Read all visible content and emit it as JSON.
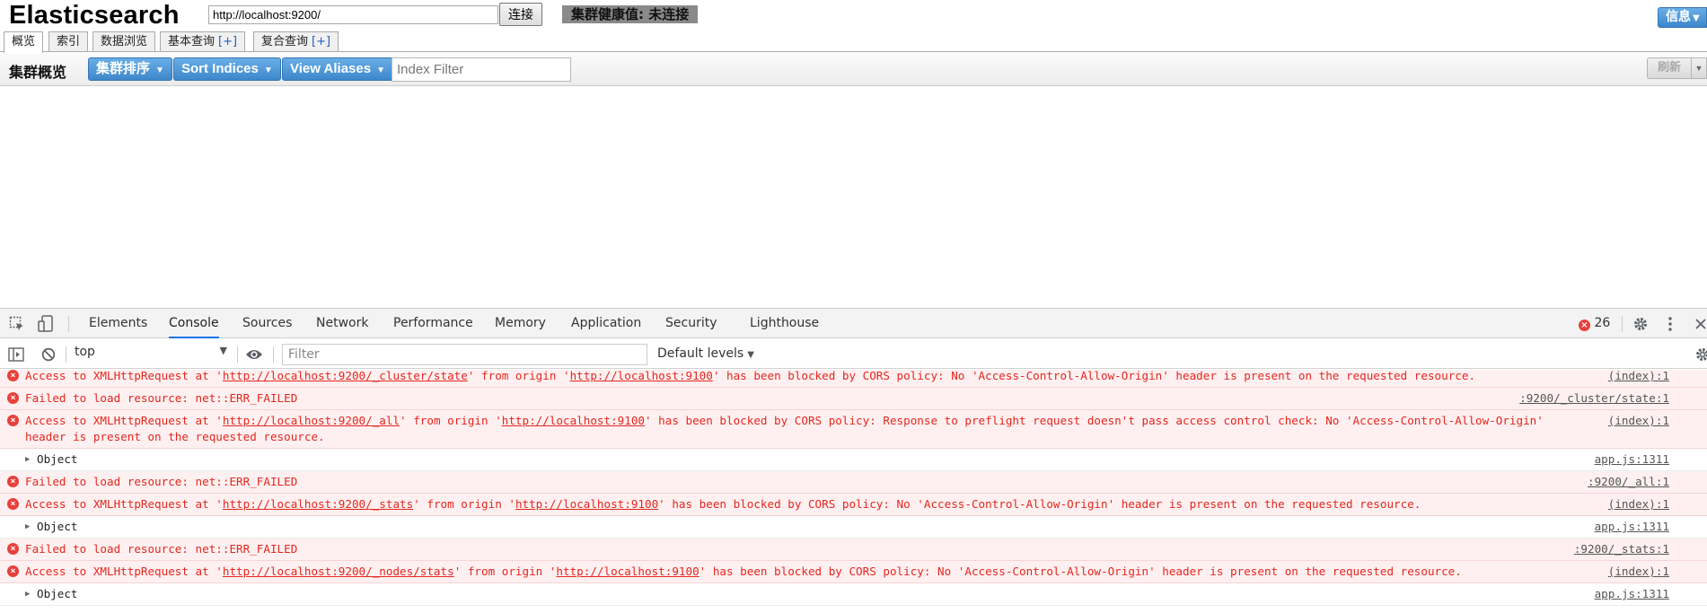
{
  "es": {
    "logo": "Elasticsearch",
    "connect_url": "http://localhost:9200/",
    "connect_button": "连接",
    "health_status": "集群健康值: 未连接",
    "info_button": "信息",
    "tabs": [
      {
        "label": "概览",
        "plus": ""
      },
      {
        "label": "索引",
        "plus": ""
      },
      {
        "label": "数据浏览",
        "plus": ""
      },
      {
        "label": "基本查询",
        "plus": "[+]"
      },
      {
        "label": "复合查询",
        "plus": "[+]"
      }
    ],
    "toolbar": {
      "title": "集群概览",
      "cluster_sort": "集群排序",
      "sort_indices": "Sort Indices",
      "view_aliases": "View Aliases",
      "index_filter_placeholder": "Index Filter",
      "refresh": "刷新"
    },
    "accent": "#3d87cc"
  },
  "devtools": {
    "tabs": [
      "Elements",
      "Console",
      "Sources",
      "Network",
      "Performance",
      "Memory",
      "Application",
      "Security",
      "Lighthouse"
    ],
    "active_tab": "Console",
    "error_count": "26",
    "context": "top",
    "filter_placeholder": "Filter",
    "levels": "Default levels",
    "logs": [
      {
        "type": "error",
        "parts": [
          "Access to XMLHttpRequest at '",
          "http://localhost:9200/_cluster/state",
          "' from origin '",
          "http://localhost:9100",
          "' has been blocked by CORS policy: No 'Access-Control-Allow-Origin' header is present on the requested resource."
        ],
        "source": "(index):1"
      },
      {
        "type": "error",
        "parts": [
          "Failed to load resource: net::ERR_FAILED"
        ],
        "source": ":9200/_cluster/state:1"
      },
      {
        "type": "error",
        "parts": [
          "Access to XMLHttpRequest at '",
          "http://localhost:9200/_all",
          "' from origin '",
          "http://localhost:9100",
          "' has been blocked by CORS policy: Response to preflight request doesn't pass access control check: No 'Access-Control-Allow-Origin' header is present on the requested resource."
        ],
        "source": "(index):1"
      },
      {
        "type": "info",
        "parts": [
          "Object"
        ],
        "source": "app.js:1311"
      },
      {
        "type": "error",
        "parts": [
          "Failed to load resource: net::ERR_FAILED"
        ],
        "source": ":9200/_all:1"
      },
      {
        "type": "error",
        "parts": [
          "Access to XMLHttpRequest at '",
          "http://localhost:9200/_stats",
          "' from origin '",
          "http://localhost:9100",
          "' has been blocked by CORS policy: No 'Access-Control-Allow-Origin' header is present on the requested resource."
        ],
        "source": "(index):1"
      },
      {
        "type": "info",
        "parts": [
          "Object"
        ],
        "source": "app.js:1311"
      },
      {
        "type": "error",
        "parts": [
          "Failed to load resource: net::ERR_FAILED"
        ],
        "source": ":9200/_stats:1"
      },
      {
        "type": "error",
        "parts": [
          "Access to XMLHttpRequest at '",
          "http://localhost:9200/_nodes/stats",
          "' from origin '",
          "http://localhost:9100",
          "' has been blocked by CORS policy: No 'Access-Control-Allow-Origin' header is present on the requested resource."
        ],
        "source": "(index):1"
      },
      {
        "type": "info",
        "parts": [
          "Object"
        ],
        "source": "app.js:1311"
      }
    ],
    "colors": {
      "error_text": "#e5261f",
      "error_bg": "#fef0f0",
      "active_tab_underline": "#1a73e8"
    }
  }
}
